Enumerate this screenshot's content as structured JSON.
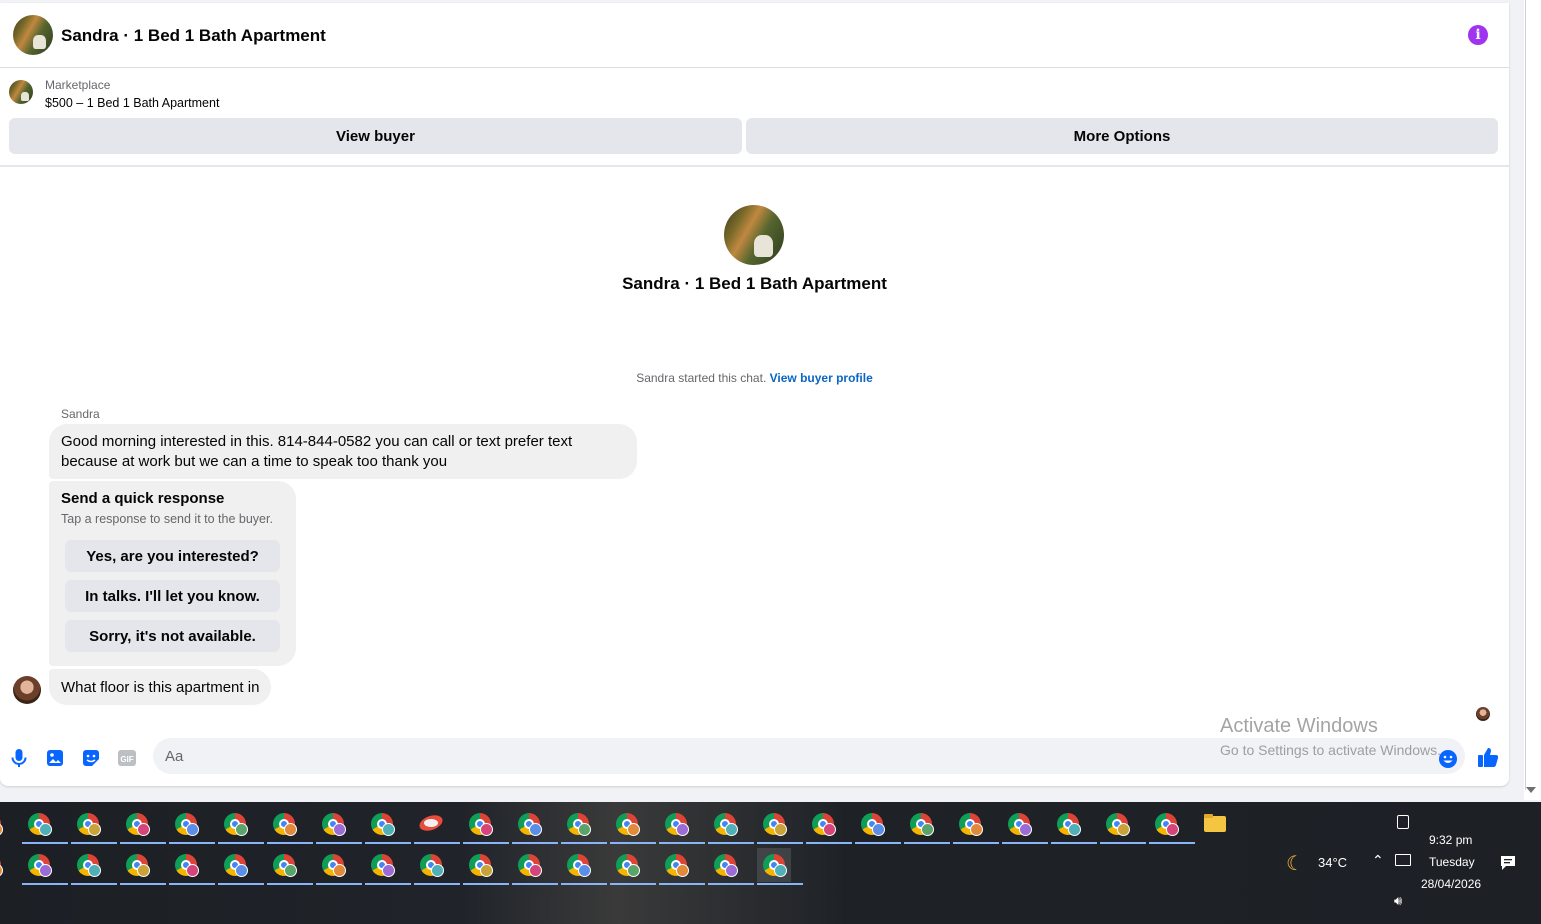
{
  "header": {
    "title": "Sandra · 1 Bed 1 Bath Apartment",
    "info_icon": "info-icon"
  },
  "listing": {
    "label": "Marketplace",
    "price_title": "$500 – 1 Bed 1 Bath Apartment",
    "view_buyer": "View buyer",
    "more_options": "More Options"
  },
  "intro": {
    "title": "Sandra · 1 Bed 1 Bath Apartment",
    "started_text": "Sandra started this chat.",
    "view_profile": "View buyer profile"
  },
  "messages": {
    "sender": "Sandra",
    "first": "Good morning interested in this.  814-844-0582 you can call or text prefer text because at work  but we can a time to speak too thank you",
    "last": "What floor is this apartment in"
  },
  "quick_response": {
    "heading": "Send a quick response",
    "subtext": "Tap a response to send it to the buyer.",
    "options": [
      "Yes, are you interested?",
      "In talks. I'll let you know.",
      "Sorry, it's not available."
    ]
  },
  "composer": {
    "placeholder": "Aa",
    "icons": [
      "microphone-icon",
      "photo-icon",
      "sticker-icon",
      "gif-icon",
      "emoji-icon",
      "thumbs-up-icon"
    ],
    "gif_label": "GIF"
  },
  "watermark": {
    "line1": "Activate Windows",
    "line2": "Go to Settings to activate Windows."
  },
  "taskbar": {
    "weather_temp": "34°C",
    "time": "9:32 pm",
    "day": "Tuesday",
    "date": "28/04/2026"
  },
  "colors": {
    "accent": "#a033f0",
    "link": "#0a66c2",
    "messenger_blue": "#0866ff"
  }
}
